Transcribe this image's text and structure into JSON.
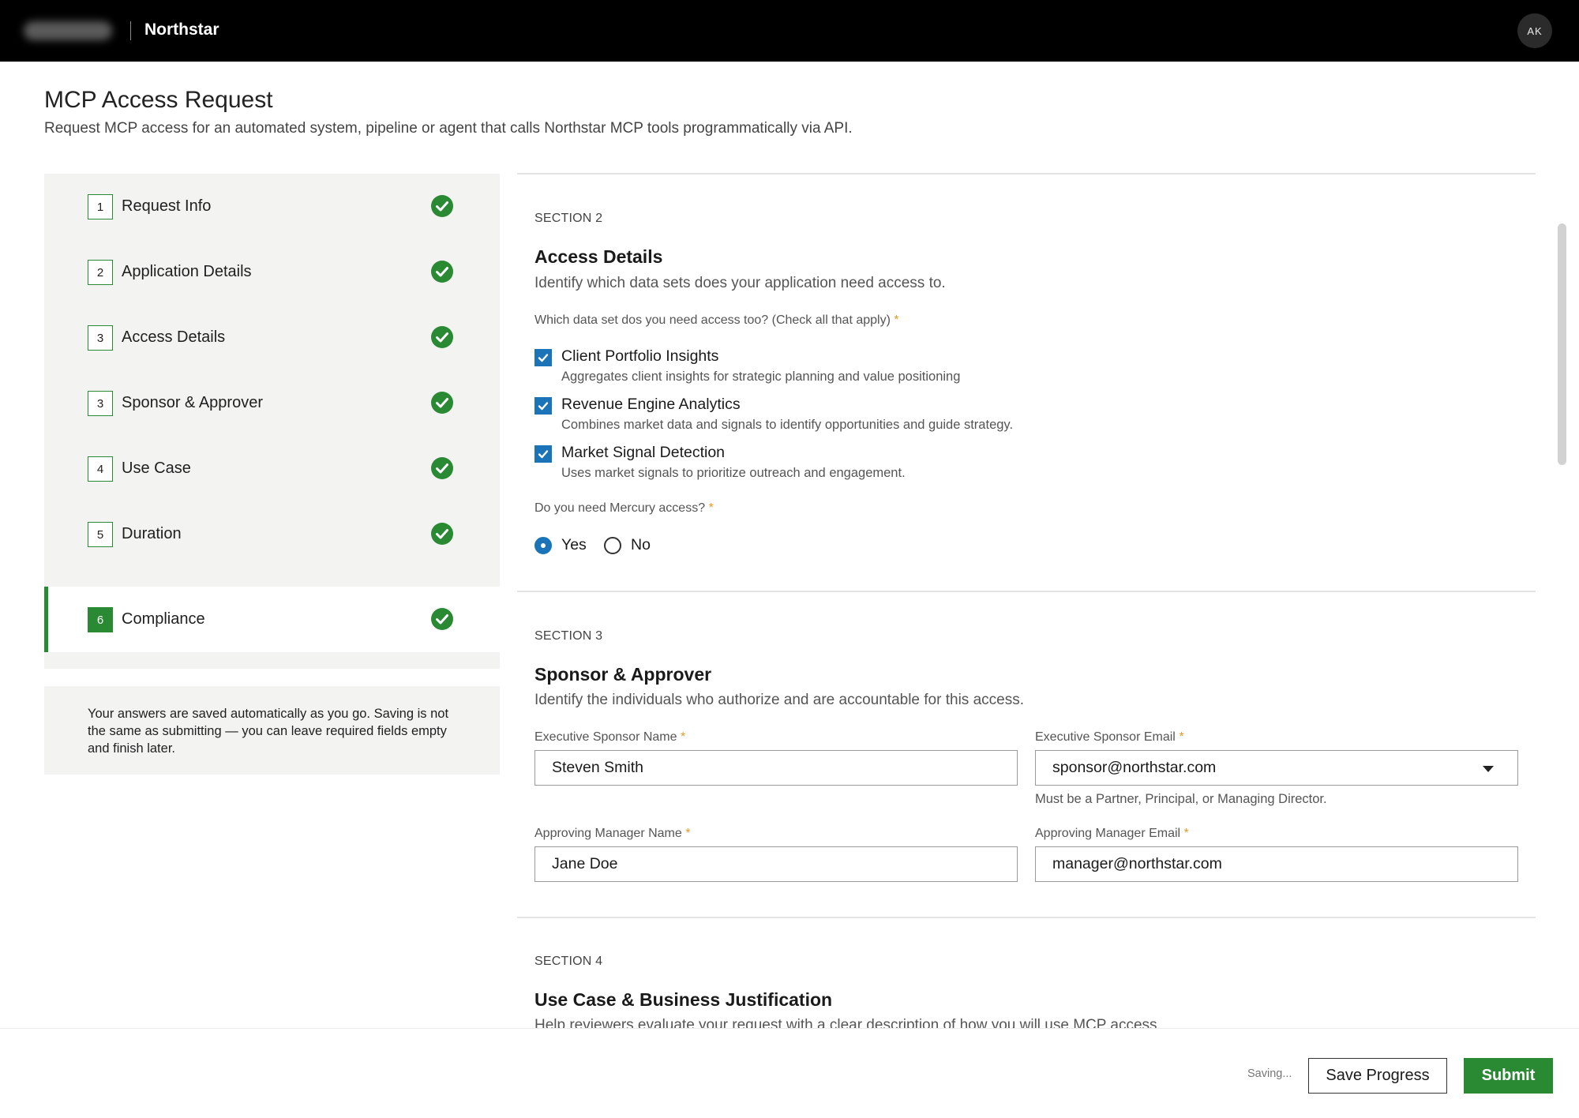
{
  "header": {
    "app_name": "Northstar",
    "avatar_initials": "AK"
  },
  "page": {
    "title": "MCP Access Request",
    "subtitle": "Request MCP access for an automated system, pipeline or agent that calls Northstar MCP tools programmatically via API."
  },
  "steps": [
    {
      "number": "1",
      "label": "Request Info",
      "complete": true
    },
    {
      "number": "2",
      "label": "Application Details",
      "complete": true
    },
    {
      "number": "3",
      "label": "Access Details",
      "complete": true
    },
    {
      "number": "3",
      "label": "Sponsor & Approver",
      "complete": true
    },
    {
      "number": "4",
      "label": "Use Case",
      "complete": true
    },
    {
      "number": "5",
      "label": "Duration",
      "complete": true
    },
    {
      "number": "6",
      "label": "Compliance",
      "complete": true,
      "active": true
    }
  ],
  "autosave_note": "Your answers are saved automatically as you go. Saving is not the same as submitting — you can leave required fields empty and finish later.",
  "section2": {
    "label": "SECTION 2",
    "title": "Access Details",
    "description": "Identify which data sets does your application need access to.",
    "datasets_question": "Which data set dos you need access too? (Check all that apply)",
    "datasets": [
      {
        "title": "Client Portfolio Insights",
        "description": "Aggregates client insights for strategic planning and value positioning",
        "checked": true
      },
      {
        "title": "Revenue Engine Analytics",
        "description": "Combines market data and signals to identify opportunities and guide strategy.",
        "checked": true
      },
      {
        "title": "Market Signal Detection",
        "description": "Uses market signals to prioritize outreach and engagement.",
        "checked": true
      }
    ],
    "mercury_question": "Do you need Mercury access?",
    "mercury_options": [
      "Yes",
      "No"
    ],
    "mercury_selected": "Yes"
  },
  "section3": {
    "label": "SECTION 3",
    "title": "Sponsor & Approver",
    "description": "Identify the individuals who authorize and are accountable for this access.",
    "sponsor_name_label": "Executive Sponsor Name",
    "sponsor_name_value": "Steven Smith",
    "sponsor_email_label": "Executive Sponsor Email",
    "sponsor_email_value": "sponsor@northstar.com",
    "sponsor_email_help": "Must be a Partner, Principal, or Managing Director.",
    "manager_name_label": "Approving Manager Name",
    "manager_name_value": "Jane Doe",
    "manager_email_label": "Approving Manager Email",
    "manager_email_value": "manager@northstar.com"
  },
  "section4": {
    "label": "SECTION 4",
    "title": "Use Case & Business Justification",
    "description": "Help reviewers evaluate your request with a clear description of how you will use MCP access."
  },
  "footer": {
    "status": "Saving...",
    "save_label": "Save Progress",
    "submit_label": "Submit"
  },
  "colors": {
    "accent_green": "#2a8a34",
    "accent_blue": "#1b74b8",
    "required_star": "#e89b25"
  },
  "required_mark": "*"
}
